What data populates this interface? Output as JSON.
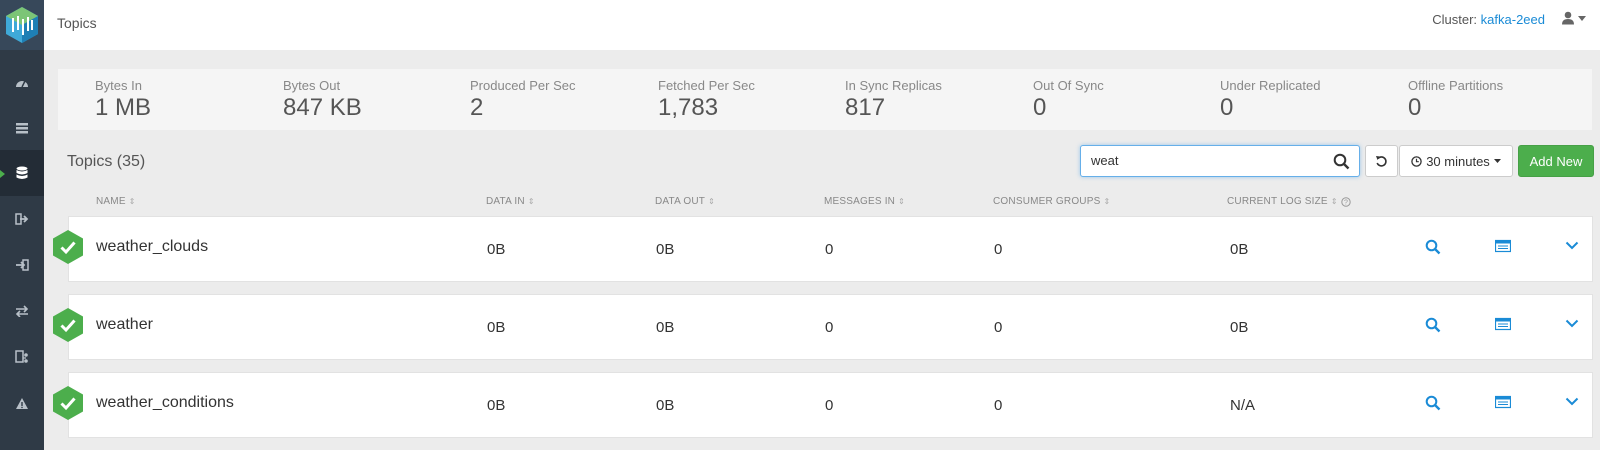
{
  "header": {
    "title": "Topics",
    "cluster_label": "Cluster:",
    "cluster_name": "kafka-2eed"
  },
  "sidebar": {
    "items": [
      {
        "icon": "dashboard-icon"
      },
      {
        "icon": "brokers-icon"
      },
      {
        "icon": "topics-icon",
        "active": true
      },
      {
        "icon": "producers-icon"
      },
      {
        "icon": "consumers-icon"
      },
      {
        "icon": "replication-icon"
      },
      {
        "icon": "schema-icon"
      },
      {
        "icon": "alert-icon"
      }
    ]
  },
  "stats": [
    {
      "label": "Bytes In",
      "value": "1 MB"
    },
    {
      "label": "Bytes Out",
      "value": "847 KB"
    },
    {
      "label": "Produced Per Sec",
      "value": "2"
    },
    {
      "label": "Fetched Per Sec",
      "value": "1,783"
    },
    {
      "label": "In Sync Replicas",
      "value": "817"
    },
    {
      "label": "Out Of Sync",
      "value": "0"
    },
    {
      "label": "Under Replicated",
      "value": "0"
    },
    {
      "label": "Offline Partitions",
      "value": "0"
    }
  ],
  "toolbar": {
    "count_label": "Topics (35)",
    "search_value": "weat",
    "time_range": "30 minutes",
    "add_label": "Add New"
  },
  "columns": [
    "NAME",
    "DATA IN",
    "DATA OUT",
    "MESSAGES IN",
    "CONSUMER GROUPS",
    "CURRENT LOG SIZE"
  ],
  "rows": [
    {
      "name": "weather_clouds",
      "data_in": "0B",
      "data_out": "0B",
      "messages_in": "0",
      "consumer_groups": "0",
      "log_size": "0B"
    },
    {
      "name": "weather",
      "data_in": "0B",
      "data_out": "0B",
      "messages_in": "0",
      "consumer_groups": "0",
      "log_size": "0B"
    },
    {
      "name": "weather_conditions",
      "data_in": "0B",
      "data_out": "0B",
      "messages_in": "0",
      "consumer_groups": "0",
      "log_size": "N/A"
    }
  ],
  "colors": {
    "accent": "#1a8bd6",
    "success": "#4cae4c",
    "sidebar": "#2f3a46"
  }
}
